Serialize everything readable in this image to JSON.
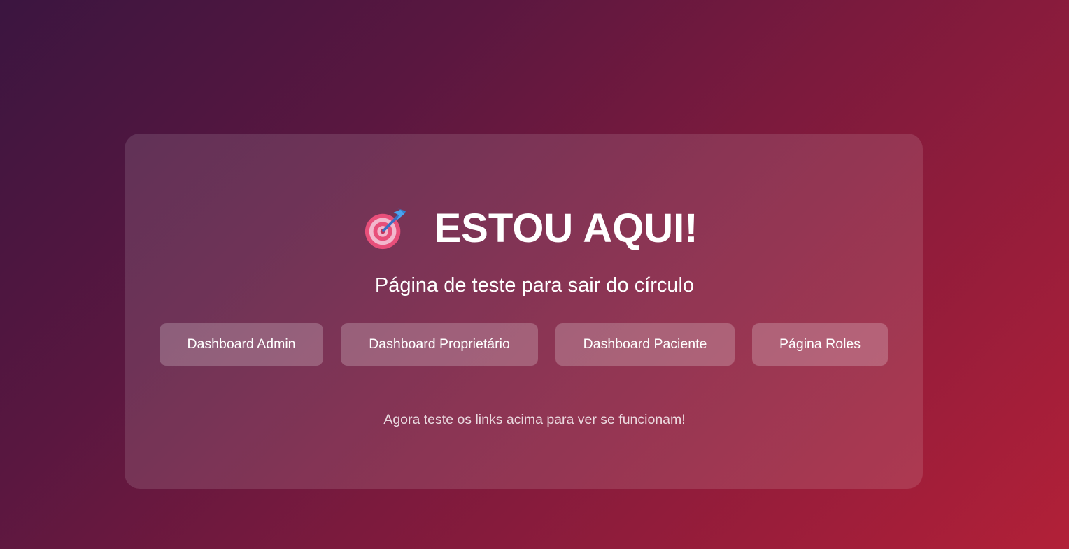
{
  "page": {
    "title_icon": "target-dart-icon",
    "title": "ESTOU AQUI!",
    "subtitle": "Página de teste para sair do círculo",
    "footer_note": "Agora teste os links acima para ver se funcionam!"
  },
  "nav": {
    "items": [
      {
        "label": "Dashboard Admin"
      },
      {
        "label": "Dashboard Proprietário"
      },
      {
        "label": "Dashboard Paciente"
      },
      {
        "label": "Página Roles"
      }
    ]
  },
  "colors": {
    "background_start": "#3b1540",
    "background_end": "#b22038",
    "text": "#ffffff"
  }
}
